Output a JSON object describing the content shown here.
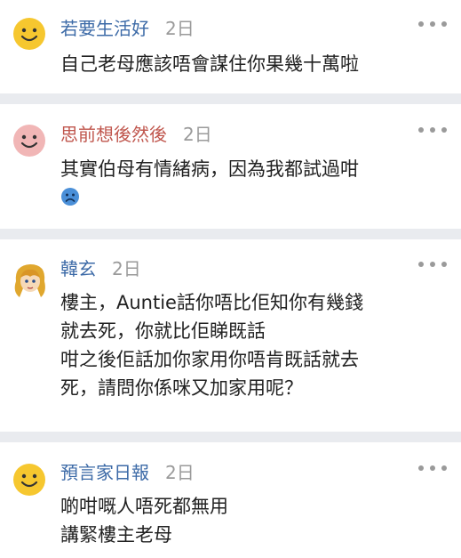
{
  "comments": [
    {
      "author": "若要生活好",
      "date": "2日",
      "lines": [
        "自己老母應該唔會謀住你果幾十萬啦"
      ]
    },
    {
      "author": "思前想後然後",
      "date": "2日",
      "lines": [
        "其實伯母有情緒病，因為我都試過咁"
      ],
      "emoji": "sad-face-emoji"
    },
    {
      "author": "韓玄",
      "date": "2日",
      "lines": [
        "樓主，Auntie話你唔比佢知你有幾錢",
        "就去死，你就比佢睇既話",
        "咁之後佢話加你家用你唔肯既話就去",
        "死，請問你係咪又加家用呢？"
      ]
    },
    {
      "author": "預言家日報",
      "date": "2日",
      "lines": [
        "啲咁嘅人唔死都無用",
        "講緊樓主老母"
      ]
    }
  ],
  "icons": {
    "avatar_default": "smiley-face-icon",
    "avatar_pink": "pink-smiley-face-icon",
    "avatar_anime": "anime-girl-avatar",
    "more": "more-options-icon"
  },
  "colors": {
    "author_blue": "#3c6aa7",
    "author_red": "#c0574e",
    "separator": "#e9ebef",
    "meta_gray": "#9a9a9a"
  }
}
